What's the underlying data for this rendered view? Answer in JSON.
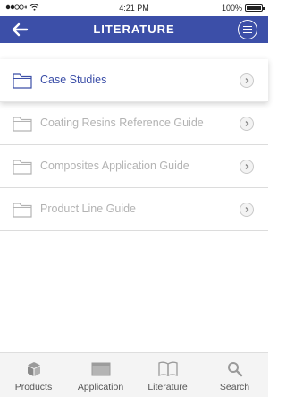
{
  "status_bar": {
    "time": "4:21 PM",
    "battery": "100%",
    "battery_level": 1.0
  },
  "header": {
    "title": "LITERATURE",
    "back_icon": "arrow-left-icon",
    "menu_icon": "menu-circle-icon"
  },
  "colors": {
    "brand": "#3c4fa8",
    "active_text": "#3c4fa8",
    "inactive_text": "#b3b3b3"
  },
  "list": {
    "items": [
      {
        "label": "Case Studies",
        "icon": "folder-icon",
        "active": true
      },
      {
        "label": "Coating Resins Reference Guide",
        "icon": "folder-icon",
        "active": false
      },
      {
        "label": "Composites Application Guide",
        "icon": "folder-icon",
        "active": false
      },
      {
        "label": "Product Line Guide",
        "icon": "folder-icon",
        "active": false
      }
    ]
  },
  "tabs": [
    {
      "label": "Products",
      "icon": "box-icon"
    },
    {
      "label": "Application",
      "icon": "panel-icon"
    },
    {
      "label": "Literature",
      "icon": "book-icon"
    },
    {
      "label": "Search",
      "icon": "search-icon"
    }
  ]
}
